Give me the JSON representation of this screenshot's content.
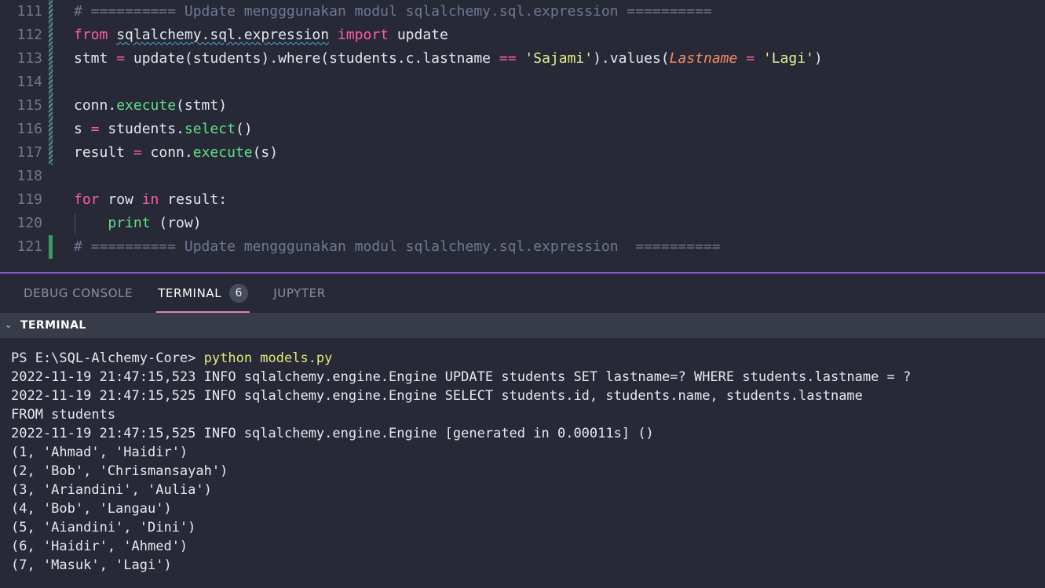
{
  "editor": {
    "language": "python",
    "first_line_number": 111,
    "lines": [
      {
        "number": "111",
        "gutter": "modified",
        "indent_guide": false,
        "tokens": [
          {
            "text": "# ========== Update mengggunakan modul sqlalchemy.sql.expression ==========",
            "style": "comment"
          }
        ]
      },
      {
        "number": "112",
        "gutter": "modified",
        "indent_guide": false,
        "tokens": [
          {
            "text": "from ",
            "style": "keyword"
          },
          {
            "text": "sqlalchemy.sql.expression",
            "style": "plain-squiggle"
          },
          {
            "text": " ",
            "style": "plain"
          },
          {
            "text": "import",
            "style": "keyword"
          },
          {
            "text": " update",
            "style": "plain"
          }
        ]
      },
      {
        "number": "113",
        "gutter": "modified",
        "indent_guide": false,
        "tokens": [
          {
            "text": "stmt ",
            "style": "plain"
          },
          {
            "text": "=",
            "style": "op"
          },
          {
            "text": " update(students).where(students.c.lastname ",
            "style": "plain"
          },
          {
            "text": "==",
            "style": "op"
          },
          {
            "text": " ",
            "style": "plain"
          },
          {
            "text": "'Sajami'",
            "style": "str"
          },
          {
            "text": ").values(",
            "style": "plain"
          },
          {
            "text": "Lastname",
            "style": "param"
          },
          {
            "text": " ",
            "style": "plain"
          },
          {
            "text": "=",
            "style": "op"
          },
          {
            "text": " ",
            "style": "plain"
          },
          {
            "text": "'Lagi'",
            "style": "str"
          },
          {
            "text": ")",
            "style": "plain"
          }
        ]
      },
      {
        "number": "114",
        "gutter": "modified",
        "indent_guide": false,
        "tokens": []
      },
      {
        "number": "115",
        "gutter": "modified",
        "indent_guide": false,
        "tokens": [
          {
            "text": "conn.",
            "style": "plain"
          },
          {
            "text": "execute",
            "style": "fn"
          },
          {
            "text": "(stmt)",
            "style": "plain"
          }
        ]
      },
      {
        "number": "116",
        "gutter": "modified",
        "indent_guide": false,
        "tokens": [
          {
            "text": "s ",
            "style": "plain"
          },
          {
            "text": "=",
            "style": "op"
          },
          {
            "text": " students.",
            "style": "plain"
          },
          {
            "text": "select",
            "style": "fn"
          },
          {
            "text": "()",
            "style": "plain"
          }
        ]
      },
      {
        "number": "117",
        "gutter": "modified",
        "indent_guide": false,
        "tokens": [
          {
            "text": "result ",
            "style": "plain"
          },
          {
            "text": "=",
            "style": "op"
          },
          {
            "text": " conn.",
            "style": "plain"
          },
          {
            "text": "execute",
            "style": "fn"
          },
          {
            "text": "(s)",
            "style": "plain"
          }
        ]
      },
      {
        "number": "118",
        "gutter": "none",
        "indent_guide": false,
        "tokens": []
      },
      {
        "number": "119",
        "gutter": "none",
        "indent_guide": false,
        "tokens": [
          {
            "text": "for",
            "style": "keyword"
          },
          {
            "text": " row ",
            "style": "plain"
          },
          {
            "text": "in",
            "style": "keyword"
          },
          {
            "text": " result:",
            "style": "plain"
          }
        ]
      },
      {
        "number": "120",
        "gutter": "none",
        "indent_guide": true,
        "tokens": [
          {
            "text": "    ",
            "style": "plain"
          },
          {
            "text": "print",
            "style": "builtin"
          },
          {
            "text": " (row)",
            "style": "plain"
          }
        ]
      },
      {
        "number": "121",
        "gutter": "added",
        "indent_guide": false,
        "tokens": [
          {
            "text": "# ========== Update mengggunakan modul sqlalchemy.sql.expression  ==========",
            "style": "comment"
          }
        ]
      }
    ]
  },
  "panel": {
    "tabs": [
      {
        "label": "DEBUG CONSOLE",
        "active": false,
        "badge": null
      },
      {
        "label": "TERMINAL",
        "active": true,
        "badge": "6"
      },
      {
        "label": "JUPYTER",
        "active": false,
        "badge": null
      }
    ],
    "terminal_section": {
      "chevron": "⌄",
      "title": "TERMINAL"
    },
    "terminal_output": [
      {
        "segments": [
          {
            "text": "PS E:\\SQL-Alchemy-Core> ",
            "style": "out"
          },
          {
            "text": "python models.py",
            "style": "cmd"
          }
        ]
      },
      {
        "segments": [
          {
            "text": "2022-11-19 21:47:15,523 INFO sqlalchemy.engine.Engine UPDATE students SET lastname=? WHERE students.lastname = ?",
            "style": "out"
          }
        ]
      },
      {
        "segments": [
          {
            "text": "2022-11-19 21:47:15,525 INFO sqlalchemy.engine.Engine SELECT students.id, students.name, students.lastname",
            "style": "out"
          }
        ]
      },
      {
        "segments": [
          {
            "text": "FROM students",
            "style": "out"
          }
        ]
      },
      {
        "segments": [
          {
            "text": "2022-11-19 21:47:15,525 INFO sqlalchemy.engine.Engine [generated in 0.00011s] ()",
            "style": "out"
          }
        ]
      },
      {
        "segments": [
          {
            "text": "(1, 'Ahmad', 'Haidir')",
            "style": "out"
          }
        ]
      },
      {
        "segments": [
          {
            "text": "(2, 'Bob', 'Chrismansayah')",
            "style": "out"
          }
        ]
      },
      {
        "segments": [
          {
            "text": "(3, 'Ariandini', 'Aulia')",
            "style": "out"
          }
        ]
      },
      {
        "segments": [
          {
            "text": "(4, 'Bob', 'Langau')",
            "style": "out"
          }
        ]
      },
      {
        "segments": [
          {
            "text": "(5, 'Aiandini', 'Dini')",
            "style": "out"
          }
        ]
      },
      {
        "segments": [
          {
            "text": "(6, 'Haidir', 'Ahmed')",
            "style": "out"
          }
        ]
      },
      {
        "segments": [
          {
            "text": "(7, 'Masuk', 'Lagi')",
            "style": "out"
          }
        ]
      }
    ]
  },
  "colors": {
    "editor_background": "#272a36",
    "panel_border_top": "#8257be",
    "active_tab_underline": "#e07fc0",
    "terminal_header_background": "#383b48",
    "gutter_added": "#3c9a5f",
    "gutter_modified": "#5f9e9a",
    "line_number": "#717689",
    "comment": "#6e7894",
    "keyword": "#ff5d9e",
    "function": "#5ee08a",
    "string": "#e7ee8f",
    "parameter": "#f78c6c",
    "terminal_command": "#e4e77a",
    "terminal_text": "#e6e8f0"
  }
}
